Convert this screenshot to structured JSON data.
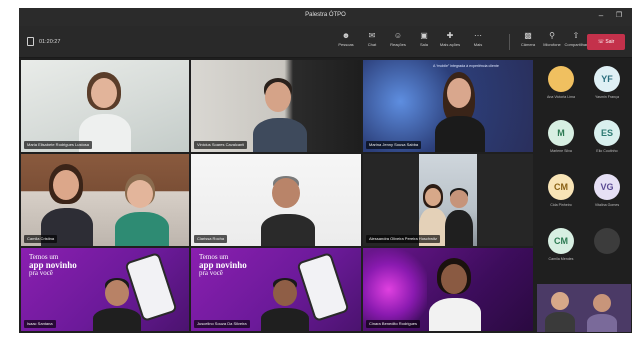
{
  "window": {
    "title": "Palestra ÓTPO"
  },
  "toolbar": {
    "timer": "01:20:27",
    "buttons": [
      {
        "label": "Pessoas",
        "icon": "people-icon"
      },
      {
        "label": "Chat",
        "icon": "chat-icon"
      },
      {
        "label": "Reações",
        "icon": "reactions-icon"
      },
      {
        "label": "Sala",
        "icon": "rooms-icon"
      },
      {
        "label": "Mais ações",
        "icon": "more-icon"
      },
      {
        "label": "Mais",
        "icon": "more-actions-icon"
      },
      {
        "label": "Câmera",
        "icon": "camera-icon"
      },
      {
        "label": "Microfone",
        "icon": "microphone-icon"
      },
      {
        "label": "Compartilhar",
        "icon": "share-icon"
      }
    ],
    "leave_label": "Sair"
  },
  "participants": [
    {
      "name": "Maria Elisabete Rodrigues Lustosa"
    },
    {
      "name": "Vinicius Soares Cavalcanti"
    },
    {
      "name": "Marina Jenny Sousa Sabba"
    },
    {
      "name": "Camila Cristina"
    },
    {
      "name": "Clarissa Rocha"
    },
    {
      "name": "Alessandra Oliveira Pereira Hoschwitz"
    },
    {
      "name": "Isaac Santana"
    },
    {
      "name": "Juscelino Souza Da Silveira"
    },
    {
      "name": "Cinara Benedito Rodrigues"
    }
  ],
  "promo": {
    "line1": "Temos um",
    "line2": "app novinho",
    "line3": "pra você"
  },
  "slide": {
    "caption": "A “mobile” integrada à experiência cliente"
  },
  "gallery": [
    {
      "initials": "",
      "name": "Ana Victoria Lima",
      "bg": "#f0c060",
      "fg": "#2e6b2e"
    },
    {
      "initials": "YF",
      "name": "Yasmin França",
      "bg": "#dff0f5",
      "fg": "#2c6f7f"
    },
    {
      "initials": "M",
      "name": "Marlene Silva",
      "bg": "#d7efe2",
      "fg": "#2d7a53"
    },
    {
      "initials": "ES",
      "name": "Elio Coutinho",
      "bg": "#d9f0ee",
      "fg": "#2e7a73"
    },
    {
      "initials": "CM",
      "name": "Cida Pinheiro",
      "bg": "#f8e4b6",
      "fg": "#8a6114"
    },
    {
      "initials": "VG",
      "name": "Vitalina Gomes",
      "bg": "#e6e0f5",
      "fg": "#5b4a94"
    },
    {
      "initials": "CM",
      "name": "Camila Mendes",
      "bg": "#d7efe2",
      "fg": "#2d7a53"
    },
    {
      "initials": "",
      "name": "",
      "bg": "#3c3c3c",
      "fg": "#9a9a9a"
    }
  ],
  "colors": {
    "leave": "#c4314b",
    "promo_bg": "#7b1fa2",
    "promo_accent": "#c020d0"
  }
}
